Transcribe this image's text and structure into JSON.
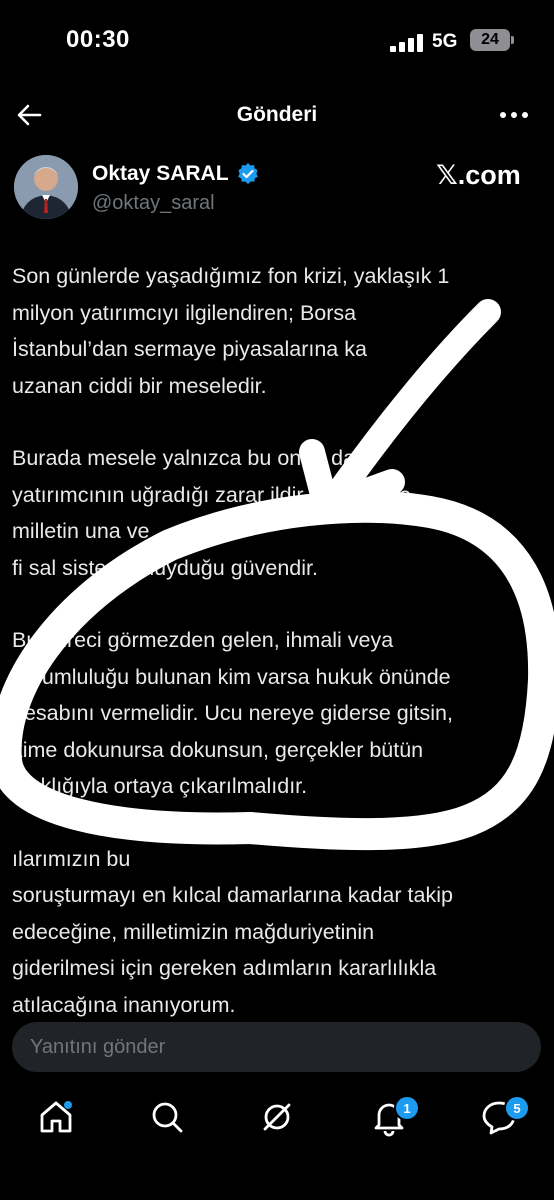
{
  "status_bar": {
    "time": "00:30",
    "network": "5G",
    "battery": "24"
  },
  "nav": {
    "title": "Gönderi",
    "back_icon": "arrow-left-icon",
    "more_icon": "more-horizontal-icon"
  },
  "author": {
    "name": "Oktay SARAL",
    "handle": "@oktay_saral",
    "verified": true,
    "source": "𝕏.com"
  },
  "tweet": {
    "paragraphs": [
      "Son günlerde yaşadığımız fon krizi, yaklaşık 1\nmilyon yatırımcıyı ilgilendiren; Borsa\nİstanbul’dan sermaye piyasalarına ka\nuzanan ciddi bir meseledir.",
      "Burada mesele yalnızca bu        onun      da\nyatırımcının uğradığı zarar        ildir.    sıl mesele,\nmilletin                                               una ve\nfi      sal sisteme duyduğu güvendir.",
      "Bu süreci görmezden gelen, ihmali veya\nsorumluluğu bulunan kim varsa hukuk önünde\nhesabını vermelidir. Ucu nereye giderse gitsin,\nkime dokunursa dokunsun, gerçekler bütün\naçıklığıyla ortaya çıkarılmalıdır.",
      "                                                    ılarımızın bu\nsoruşturmayı en kılcal damarlarına kadar takip\nedeceğine, milletimizin mağduriyetinin\ngiderilmesi için gereken adımların kararlılıkla\natılacağına inanıyorum."
    ]
  },
  "reply": {
    "placeholder": "Yanıtını gönder"
  },
  "tabs": [
    {
      "name": "home",
      "icon": "home-icon",
      "badge": ""
    },
    {
      "name": "search",
      "icon": "search-icon",
      "badge": ""
    },
    {
      "name": "grok",
      "icon": "grok-icon",
      "badge": ""
    },
    {
      "name": "notifications",
      "icon": "bell-icon",
      "badge": "1"
    },
    {
      "name": "messages",
      "icon": "chat-bubble-icon",
      "badge": "5"
    }
  ],
  "colors": {
    "accent": "#1d9bf0",
    "background": "#000000",
    "text": "#e7e9ea",
    "muted": "#71767b"
  }
}
